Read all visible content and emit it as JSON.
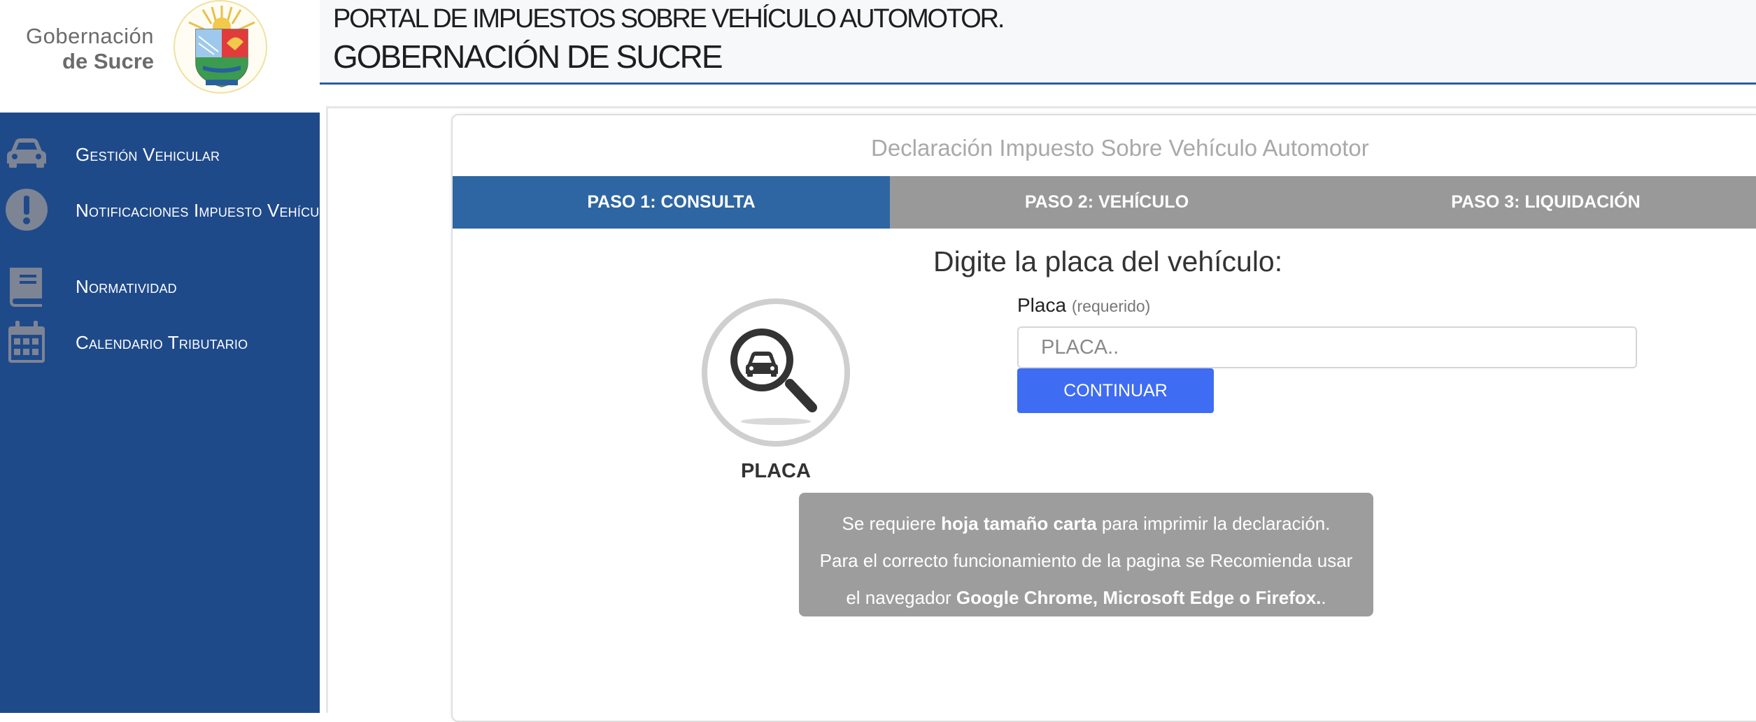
{
  "brand": {
    "line1": "Gobernación",
    "line2": "de Sucre"
  },
  "header": {
    "line1": "PORTAL DE IMPUESTOS SOBRE VEHÍCULO AUTOMOTOR.",
    "line2": "GOBERNACIÓN DE SUCRE"
  },
  "sidebar": {
    "items": [
      {
        "label": "Gestión Vehicular",
        "icon": "car-icon"
      },
      {
        "label": "Notificaciones Impuesto Vehícular",
        "icon": "alert-icon"
      },
      {
        "label": "Normatividad",
        "icon": "book-icon"
      },
      {
        "label": "Calendario Tributario",
        "icon": "calendar-icon"
      }
    ]
  },
  "card": {
    "title": "Declaración Impuesto Sobre Vehículo Automotor",
    "steps": [
      {
        "label": "PASO 1: CONSULTA",
        "active": true
      },
      {
        "label": "PASO 2: VEHÍCULO",
        "active": false
      },
      {
        "label": "PASO 3: LIQUIDACIÓN",
        "active": false
      }
    ],
    "prompt": "Digite la placa del vehículo:",
    "illustration_caption": "PLACA",
    "field": {
      "label": "Placa",
      "required_hint": "(requerido)",
      "placeholder": "PLACA..",
      "value": ""
    },
    "continue_label": "CONTINUAR"
  },
  "notice": {
    "line1_pre": "Se requiere ",
    "line1_bold": "hoja tamaño carta",
    "line1_post": " para imprimir la declaración.",
    "line2": "Para el correcto funcionamiento de la pagina se Recomienda usar",
    "line3_pre": "el navegador ",
    "line3_bold": "Google Chrome, Microsoft Edge o Firefox.",
    "line3_post": "."
  },
  "colors": {
    "sidebar_bg": "#1f4a8a",
    "step_active": "#2d66a2",
    "step_inactive": "#999999",
    "button": "#3e6cf3",
    "notice_bg": "#9d9d9d"
  }
}
